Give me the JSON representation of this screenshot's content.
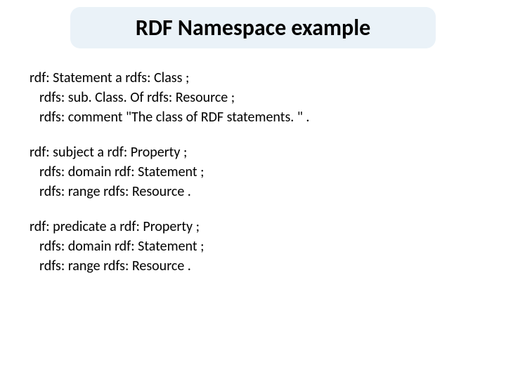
{
  "title": "RDF Namespace example",
  "blocks": [
    {
      "head": "rdf: Statement a rdfs: Class ;",
      "subs": [
        "rdfs: sub. Class. Of rdfs: Resource ;",
        "rdfs: comment \"The class of RDF statements. \" ."
      ]
    },
    {
      "head": "rdf: subject a rdf: Property ;",
      "subs": [
        "rdfs: domain rdf: Statement ;",
        "rdfs: range rdfs: Resource ."
      ]
    },
    {
      "head": "rdf: predicate a rdf: Property ;",
      "subs": [
        "rdfs: domain rdf: Statement ;",
        "rdfs: range rdfs: Resource ."
      ]
    }
  ]
}
